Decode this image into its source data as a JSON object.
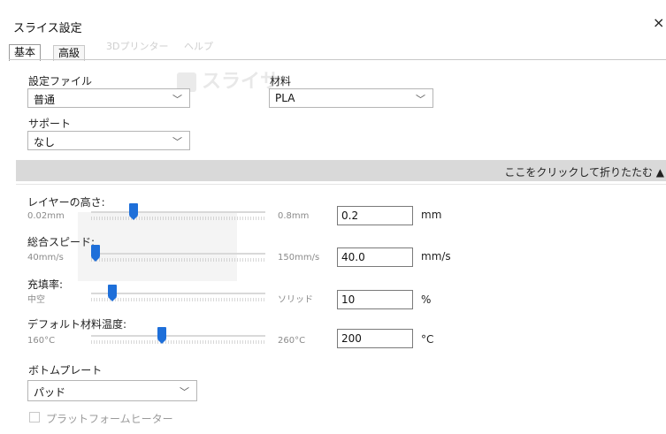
{
  "window": {
    "title": "スライス設定",
    "close_symbol": "×"
  },
  "background_app": {
    "menu": [
      "3Dプリンター",
      "ヘルプ"
    ],
    "toolbar_label": "スライサ"
  },
  "tabs": [
    {
      "label": "基本",
      "active": true
    },
    {
      "label": "高級",
      "active": false
    }
  ],
  "basic": {
    "profile_label": "設定ファイル",
    "profile_value": "普通",
    "material_label": "材料",
    "material_value": "PLA",
    "support_label": "サポート",
    "support_value": "なし",
    "collapse_label": "ここをクリックして折りたたむ ▲"
  },
  "sliders": [
    {
      "label": "レイヤーの高さ:",
      "min": "0.02mm",
      "max": "0.8mm",
      "value": "0.2",
      "unit": "mm",
      "position": 0.23
    },
    {
      "label": "総合スピード:",
      "min": "40mm/s",
      "max": "150mm/s",
      "value": "40.0",
      "unit": "mm/s",
      "position": 0.0
    },
    {
      "label": "充填率:",
      "min": "中空",
      "max": "ソリッド",
      "value": "10",
      "unit": "%",
      "position": 0.1
    },
    {
      "label": "デフォルト材料温度:",
      "min": "160°C",
      "max": "260°C",
      "value": "200",
      "unit": "°C",
      "position": 0.4
    }
  ],
  "bottom_plate": {
    "label": "ボトムプレート",
    "value": "パッド"
  },
  "platform_heater": {
    "label": "プラットフォームヒーター",
    "checked": false
  },
  "colors": {
    "accent": "#1e6fd9",
    "collapse_bar": "#d9d9d9"
  }
}
